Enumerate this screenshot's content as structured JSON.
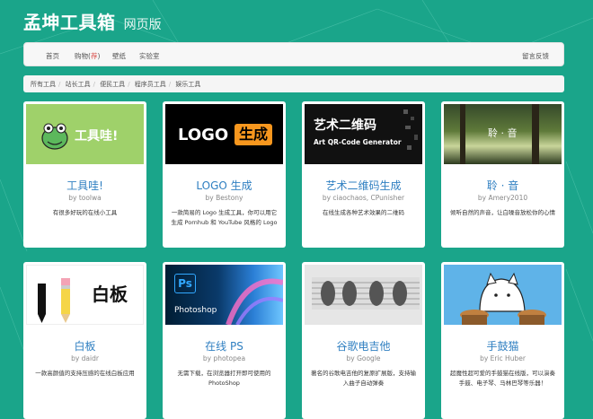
{
  "brand": {
    "title": "孟坤工具箱",
    "subtitle": "网页版"
  },
  "navbar": {
    "items": [
      {
        "label": "首页"
      },
      {
        "label": "购物(",
        "hot": "荐",
        "tail": ")"
      },
      {
        "label": "壁纸"
      },
      {
        "label": "实验室"
      }
    ],
    "right": "留言反馈"
  },
  "breadcrumb": [
    "所有工具",
    "站长工具",
    "便民工具",
    "程序员工具",
    "娱乐工具"
  ],
  "colors": {
    "background": "#1aa58a",
    "title_link": "#2f7fc1",
    "hot": "#d9534f"
  },
  "cards": [
    {
      "title": "工具哇!",
      "author": "by toolwa",
      "desc": "有很多好玩的在线小工具",
      "image_text": "工具哇!",
      "icon": "frog-icon"
    },
    {
      "title": "LOGO 生成",
      "author": "by Bestony",
      "desc": "一款简易的 Logo 生成工具，你可以用它生成 Pornhub 和 YouTube 风格的 Logo",
      "image_text_a": "LOGO",
      "image_text_b": "生成"
    },
    {
      "title": "艺术二维码生成",
      "author": "by ciaochaos, CPunisher",
      "desc": "在线生成各种艺术效果的二维码",
      "image_text_a": "艺术二维码",
      "image_text_b": "Art QR-Code Generator"
    },
    {
      "title": "聆 · 音",
      "author": "by Amery2010",
      "desc": "倾听自然的声音，让白噪音放松你的心情",
      "image_text": "聆 · 音"
    },
    {
      "title": "白板",
      "author": "by daidr",
      "desc": "一款高颜值的支持压感的在线白板应用",
      "image_text": "白板",
      "icon": "pencil-icon"
    },
    {
      "title": "在线 PS",
      "author": "by photopea",
      "desc": "无需下载，在浏览器打开即可使用的 PhotoShop",
      "image_text_a": "Ps",
      "image_text_b": "Photoshop"
    },
    {
      "title": "谷歌电吉他",
      "author": "by Google",
      "desc": "著名的谷歌电吉他的复原扩展版，支持输入曲子自动弹奏",
      "icon": "guitar-icon"
    },
    {
      "title": "手鼓猫",
      "author": "by Eric Huber",
      "desc": "超魔性超可爱的手鼓猫在线版，可以演奏手鼓、电子琴、马林巴琴等乐器！",
      "icon": "bongo-cat-icon"
    }
  ]
}
